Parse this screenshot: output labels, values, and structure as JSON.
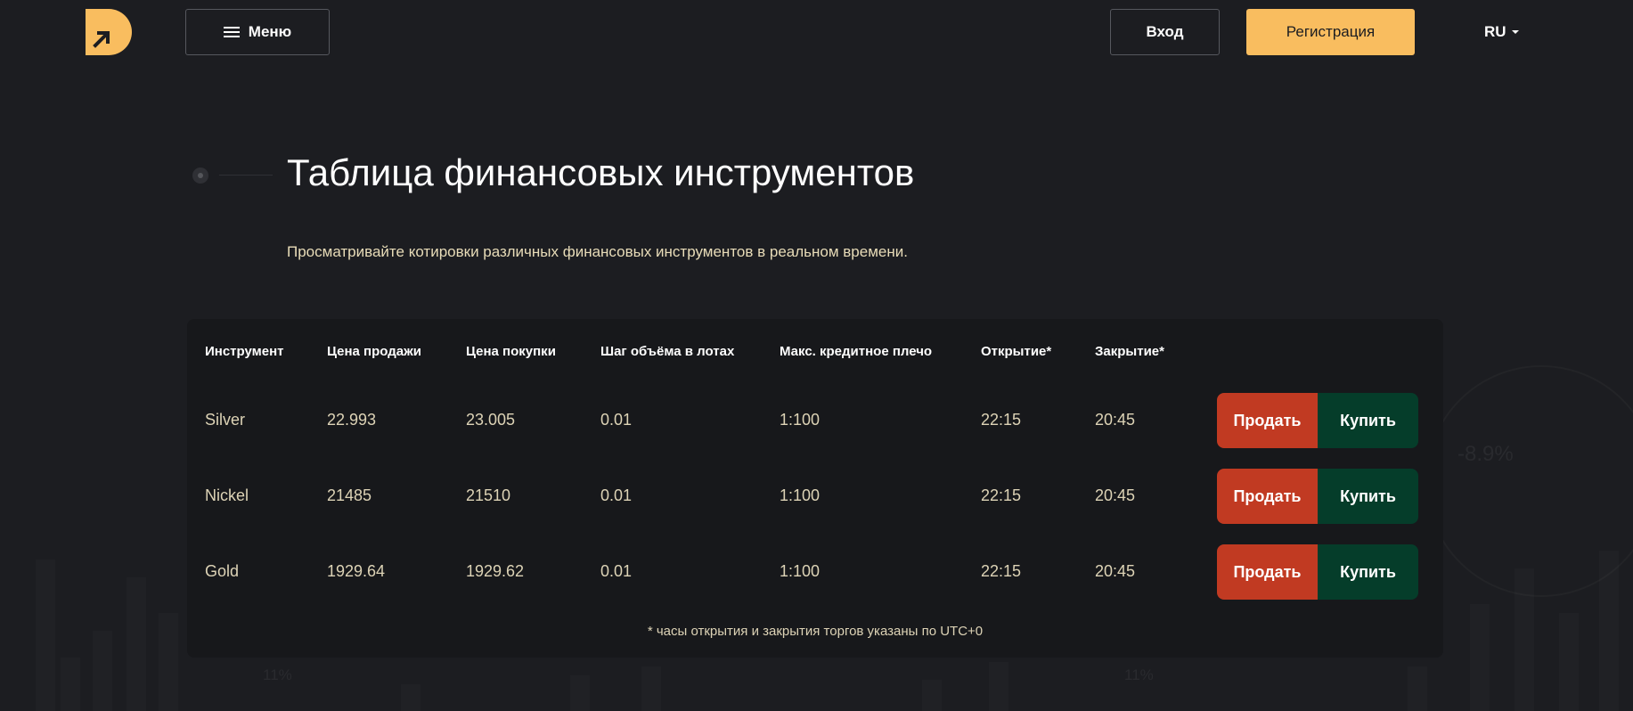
{
  "header": {
    "menu_label": "Меню",
    "login_label": "Вход",
    "register_label": "Регистрация",
    "language": "RU"
  },
  "hero": {
    "title": "Таблица финансовых инструментов",
    "subtitle": "Просматривайте котировки различных финансовых инструментов в реальном времени."
  },
  "background": {
    "pct_right": "-8.9%",
    "pct_left": "11%",
    "pct_mid": "11%"
  },
  "table": {
    "columns": [
      "Инструмент",
      "Цена продажи",
      "Цена покупки",
      "Шаг объёма в лотах",
      "Макс. кредитное плечо",
      "Открытие*",
      "Закрытие*"
    ],
    "rows": [
      {
        "instrument": "Silver",
        "sell": "22.993",
        "buy": "23.005",
        "step": "0.01",
        "leverage": "1:100",
        "open": "22:15",
        "close": "20:45"
      },
      {
        "instrument": "Nickel",
        "sell": "21485",
        "buy": "21510",
        "step": "0.01",
        "leverage": "1:100",
        "open": "22:15",
        "close": "20:45"
      },
      {
        "instrument": "Gold",
        "sell": "1929.64",
        "buy": "1929.62",
        "step": "0.01",
        "leverage": "1:100",
        "open": "22:15",
        "close": "20:45"
      }
    ],
    "sell_label": "Продать",
    "buy_label": "Купить",
    "footnote": "* часы открытия и закрытия торгов указаны по UTC+0"
  },
  "colors": {
    "accent": "#f9bd5f",
    "sell": "#c13a22",
    "buy": "#053d2a",
    "background": "#1c1d21",
    "card": "#17181b"
  }
}
